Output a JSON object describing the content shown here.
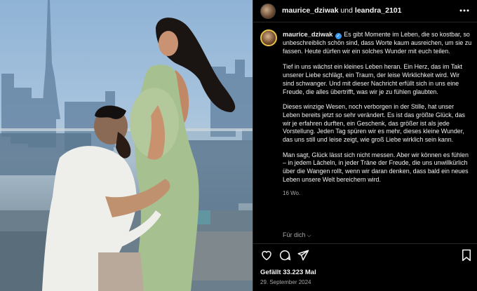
{
  "photo": {
    "description_icon": "photo-post"
  },
  "header": {
    "user1": "maurice_dziwak",
    "connector": "und",
    "user2": "leandra_2101",
    "more_icon": "more-horizontal-icon"
  },
  "caption": {
    "username": "maurice_dziwak",
    "verified": "✓",
    "paragraphs": [
      "Es gibt Momente im Leben, die so kostbar, so unbeschreiblich schön sind, dass Worte kaum ausreichen, um sie zu fassen. Heute dürfen wir ein solches Wunder mit euch teilen.",
      "Tief in uns wächst ein kleines Leben heran. Ein Herz, das im Takt unserer Liebe schlägt, ein Traum, der leise Wirklichkeit wird. Wir sind schwanger. Und mit dieser Nachricht erfüllt sich in uns eine Freude, die alles übertrifft, was wir je zu fühlen glaubten.",
      "Dieses winzige Wesen, noch verborgen in der Stille, hat unser Leben bereits jetzt so sehr verändert. Es ist das größte Glück, das wir je erfahren durften, ein Geschenk, das größer ist als jede Vorstellung. Jeden Tag spüren wir es mehr, dieses kleine Wunder, das uns still und leise zeigt, wie groß Liebe wirklich sein kann.",
      "Man sagt, Glück lässt sich nicht messen. Aber wir können es fühlen – in jedem Lächeln, in jeder Träne der Freude, die uns unwillkürlich über die Wangen rollt, wenn wir daran denken, dass bald ein neues Leben unsere Welt bereichern wird."
    ],
    "time_ago": "16 Wo.",
    "translate": "Für dich"
  },
  "actions": {
    "like_icon": "heart-icon",
    "comment_icon": "comment-icon",
    "share_icon": "share-icon",
    "save_icon": "bookmark-icon"
  },
  "likes": "Gefällt 33.223 Mal",
  "date": "29. September 2024",
  "colors": {
    "background": "#000000",
    "text": "#f5f5f5",
    "muted": "#a8a8a8",
    "verified": "#3897f0",
    "divider": "#262626"
  }
}
